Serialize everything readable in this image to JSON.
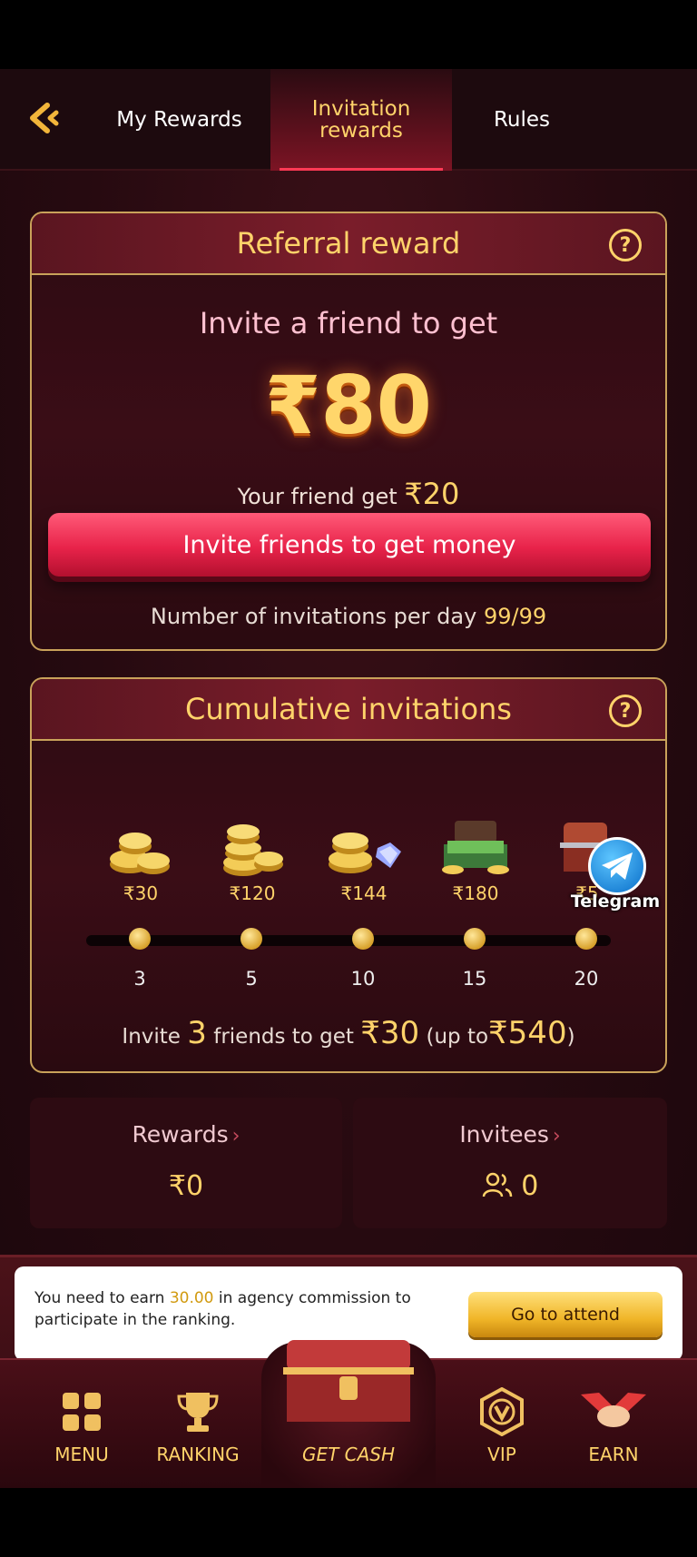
{
  "header": {
    "tabs": [
      {
        "label": "My Rewards"
      },
      {
        "label": "Invitation rewards"
      },
      {
        "label": "Rules"
      }
    ]
  },
  "referral": {
    "title": "Referral reward",
    "invite_text": "Invite a friend to get",
    "amount": "₹80",
    "friend_prefix": "Your friend get",
    "friend_amount": "₹20",
    "button_label": "Invite friends to get money",
    "per_day_prefix": "Number of invitations per day",
    "per_day_value": "99/99"
  },
  "cumulative": {
    "title": "Cumulative invitations",
    "milestones": [
      {
        "amount": "₹30",
        "count": "3",
        "icon": "coin-stack-small-icon"
      },
      {
        "amount": "₹120",
        "count": "5",
        "icon": "coin-stack-medium-icon"
      },
      {
        "amount": "₹144",
        "count": "10",
        "icon": "coins-gems-icon"
      },
      {
        "amount": "₹180",
        "count": "15",
        "icon": "cash-chest-icon"
      },
      {
        "amount": "₹5",
        "count": "20",
        "icon": "treasure-chest-icon"
      }
    ],
    "text_part1": "Invite",
    "text_count": "3",
    "text_part2": "friends to get",
    "text_amount": "₹30",
    "text_part3": "(up to",
    "text_max": "₹540",
    "text_close": ")"
  },
  "telegram": {
    "label": "Telegram",
    "icon": "telegram-icon"
  },
  "stats": {
    "rewards_label": "Rewards",
    "rewards_value": "₹0",
    "invitees_label": "Invitees",
    "invitees_value": "0"
  },
  "banner": {
    "text_prefix": "You need to earn",
    "text_amount": "30.00",
    "text_suffix": "in agency commission to participate in the ranking.",
    "button_label": "Go to attend"
  },
  "bottom_nav": {
    "menu": "MENU",
    "ranking": "RANKING",
    "get_cash": "GET CASH",
    "vip": "VIP",
    "earn": "EARN"
  },
  "colors": {
    "accent_gold": "#ffd36a",
    "button_red": "#e8234a",
    "background": "#260a10"
  }
}
